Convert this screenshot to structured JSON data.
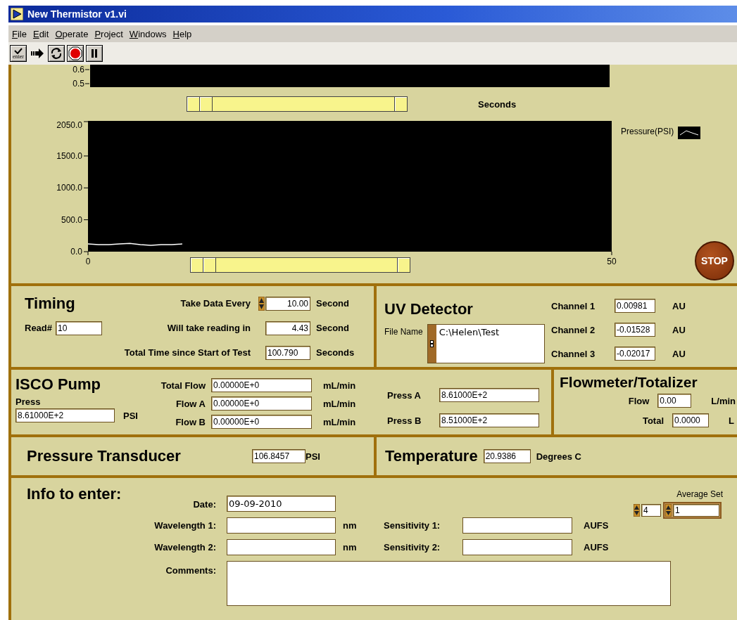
{
  "window": {
    "title": "New Thermistor v1.vi"
  },
  "menu": [
    "File",
    "Edit",
    "Operate",
    "Project",
    "Windows",
    "Help"
  ],
  "toolbar": [
    {
      "kind": "enter",
      "label": "enter"
    },
    {
      "kind": "run"
    },
    {
      "kind": "run_continuous"
    },
    {
      "kind": "abort"
    },
    {
      "kind": "pause"
    }
  ],
  "top_chart": {
    "y_labels": [
      "0.6",
      "0.5"
    ],
    "x_label": "Seconds"
  },
  "pressure_chart": {
    "chart_data": {
      "type": "line",
      "x": [
        0,
        1,
        2,
        3,
        4,
        5,
        6,
        7,
        8,
        9
      ],
      "series": [
        {
          "name": "Pressure(PSI)",
          "color": "#ffffff",
          "values": [
            120,
            110,
            110,
            120,
            130,
            110,
            100,
            110,
            110,
            120
          ]
        }
      ],
      "xlim": [
        0,
        50
      ],
      "ylim": [
        0,
        2050
      ],
      "xticks": [
        0,
        50
      ],
      "yticks": [
        {
          "value": 0,
          "label": "0.0"
        },
        {
          "value": 500,
          "label": "500.0"
        },
        {
          "value": 1000,
          "label": "1000.0"
        },
        {
          "value": 1500,
          "label": "1500.0"
        },
        {
          "value": 2050,
          "label": "2050.0"
        }
      ]
    }
  },
  "stop_button": {
    "label": "STOP"
  },
  "timing": {
    "title": "Timing",
    "read": {
      "label": "Read#",
      "value": "10"
    },
    "rows": [
      {
        "label": "Take Data Every",
        "value": "10.00",
        "unit": "Second",
        "spinner": true
      },
      {
        "label": "Will take reading in",
        "value": "4.43",
        "unit": "Second",
        "spinner": false
      },
      {
        "label": "Total Time since Start of Test",
        "value": "100.790",
        "unit": "Seconds",
        "spinner": false
      }
    ]
  },
  "uv_detector": {
    "title": "UV Detector",
    "file_name": {
      "label": "File Name",
      "value": "C:\\Helen\\Test"
    },
    "channels": [
      {
        "label": "Channel 1",
        "value": "0.00981",
        "unit": "AU"
      },
      {
        "label": "Channel 2",
        "value": "-0.01528",
        "unit": "AU"
      },
      {
        "label": "Channel 3",
        "value": "-0.02017",
        "unit": "AU"
      }
    ]
  },
  "isco_pump": {
    "title": "ISCO Pump",
    "press": {
      "label": "Press",
      "value": "8.61000E+2",
      "unit": "PSI"
    },
    "flows": [
      {
        "label": "Total Flow",
        "value": "0.00000E+0",
        "unit": "mL/min"
      },
      {
        "label": "Flow A",
        "value": "0.00000E+0",
        "unit": "mL/min"
      },
      {
        "label": "Flow B",
        "value": "0.00000E+0",
        "unit": "mL/min"
      }
    ],
    "pressures": [
      {
        "label": "Press A",
        "value": "8.61000E+2"
      },
      {
        "label": "Press B",
        "value": "8.51000E+2"
      }
    ]
  },
  "flowmeter": {
    "title": "Flowmeter/Totalizer",
    "rows": [
      {
        "label": "Flow",
        "value": "0.00",
        "unit": "L/min"
      },
      {
        "label": "Total",
        "value": "0.0000",
        "unit": "L"
      }
    ]
  },
  "pressure_transducer": {
    "title": "Pressure Transducer",
    "value": "106.8457",
    "unit": "PSI"
  },
  "temperature": {
    "title": "Temperature",
    "value": "20.9386",
    "unit": "Degrees C"
  },
  "info": {
    "title": "Info to enter:",
    "date": {
      "label": "Date:",
      "value": "09-09-2010"
    },
    "rows": [
      {
        "label": "Wavelength 1:",
        "unit": "nm",
        "sensitivity_label": "Sensitivity 1:",
        "sensitivity_unit": "AUFS"
      },
      {
        "label": "Wavelength 2:",
        "unit": "nm",
        "sensitivity_label": "Sensitivity 2:",
        "sensitivity_unit": "AUFS"
      }
    ],
    "comments": {
      "label": "Comments:"
    },
    "average_set": {
      "label": "Average Set",
      "spinners": [
        "4",
        "1"
      ]
    }
  }
}
